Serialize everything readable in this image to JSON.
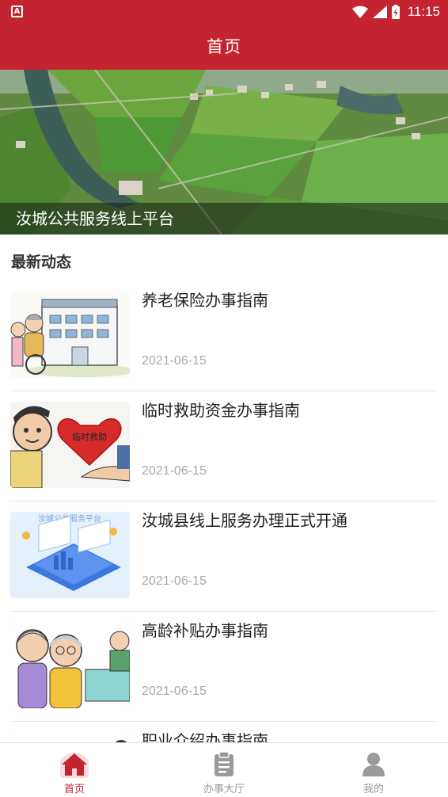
{
  "status_bar": {
    "time": "11:15",
    "app_icon": "A"
  },
  "header": {
    "title": "首页"
  },
  "banner": {
    "caption": "汝城公共服务线上平台"
  },
  "section": {
    "title": "最新动态"
  },
  "news": [
    {
      "title": "养老保险办事指南",
      "date": "2021-06-15",
      "thumb": "elderly-pension-illustration"
    },
    {
      "title": "临时救助资金办事指南",
      "date": "2021-06-15",
      "thumb": "temporary-relief-illustration",
      "thumb_text": "临时救助"
    },
    {
      "title": "汝城县线上服务办理正式开通",
      "date": "2021-06-15",
      "thumb": "online-platform-illustration",
      "thumb_text": "汝城公共服务平台"
    },
    {
      "title": "高龄补贴办事指南",
      "date": "2021-06-15",
      "thumb": "senior-subsidy-illustration"
    },
    {
      "title": "职业介绍办事指南",
      "date": "",
      "thumb": "job-intro-illustration"
    }
  ],
  "bottom_nav": {
    "home": "首页",
    "service_hall": "办事大厅",
    "mine": "我的"
  },
  "colors": {
    "primary": "#c42430",
    "inactive": "#9a9a9a",
    "date": "#a9a9a9"
  }
}
